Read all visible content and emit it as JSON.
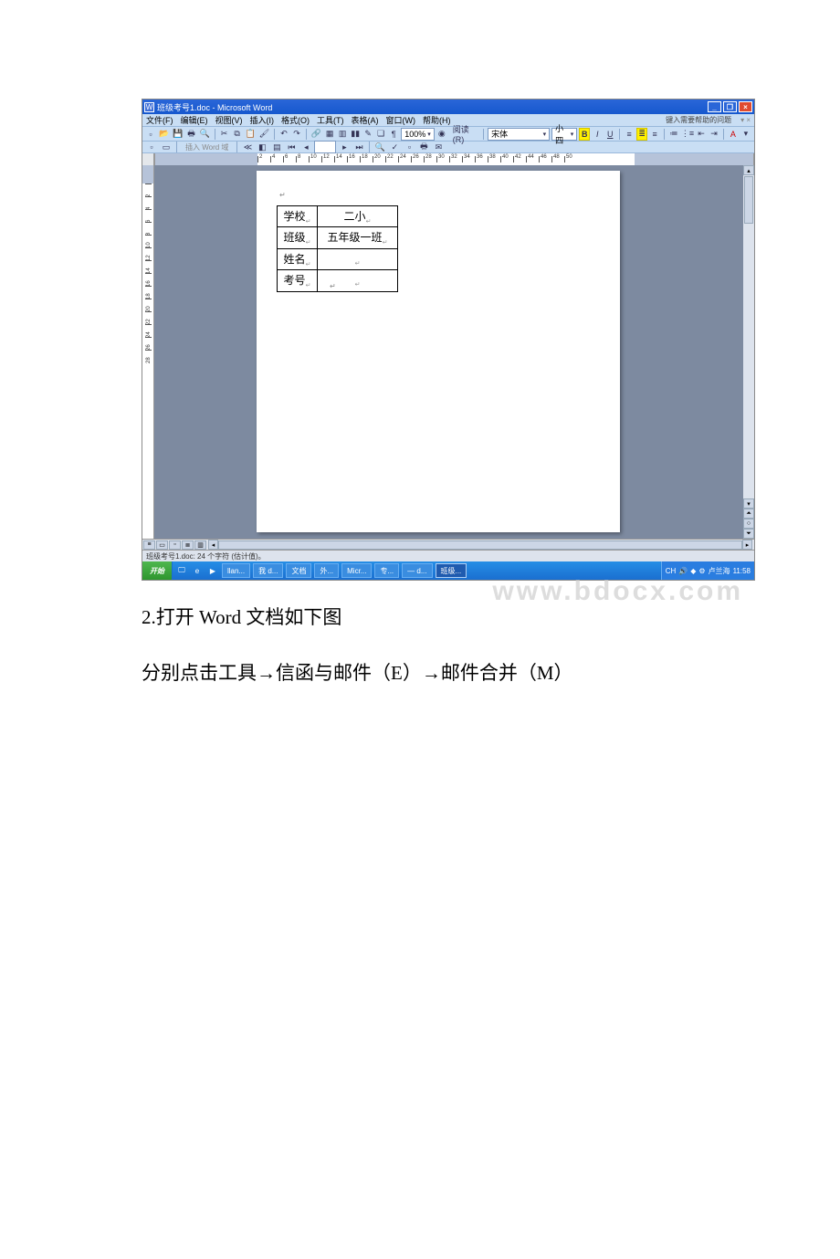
{
  "word_window": {
    "title_icon": "W",
    "title": "班级考号1.doc - Microsoft Word",
    "help_hint": "键入需要帮助的问题",
    "help_x": "▾ ×",
    "win_min": "_",
    "win_max": "❐",
    "win_close": "×",
    "menus": [
      "文件(F)",
      "编辑(E)",
      "视图(V)",
      "插入(I)",
      "格式(O)",
      "工具(T)",
      "表格(A)",
      "窗口(W)",
      "帮助(H)"
    ],
    "toolbar1": {
      "zoom": "100%",
      "read_btn": "阅读(R)",
      "font_name": "宋体",
      "font_size": "小四"
    },
    "toolbar2_label": "插入 Word 域",
    "ruler_ticks": [
      "2",
      "4",
      "6",
      "8",
      "10",
      "12",
      "14",
      "16",
      "18",
      "20",
      "22",
      "24",
      "26",
      "28",
      "30",
      "32",
      "34",
      "36",
      "38",
      "40",
      "42",
      "44",
      "46",
      "48",
      "50"
    ],
    "vruler_ticks": [
      "2",
      "4",
      "6",
      "8",
      "10",
      "12",
      "14",
      "16",
      "18",
      "20",
      "22",
      "24",
      "26",
      "28"
    ],
    "table": {
      "r1l": "学校",
      "r1v": "二小",
      "r2l": "班级",
      "r2v": "五年级一班",
      "r3l": "姓名",
      "r3v": "",
      "r4l": "考号",
      "r4v": ""
    },
    "status": "班级考号1.doc: 24 个字符 (估计值)。",
    "taskbar": {
      "start": "开始",
      "items": [
        "llan...",
        "我 d...",
        "文档",
        "外...",
        "Micr...",
        "专...",
        "— d...",
        "班级..."
      ],
      "lang": "CH",
      "tray_user": "卢兰海",
      "clock": "11:58"
    }
  },
  "watermark": "www.bdocx.com",
  "body": {
    "line1_prefix": "2.",
    "line1_mid1": "打开 ",
    "line1_word": "Word ",
    "line1_mid2": "文档如下图",
    "line2": "分别点击工具→信函与邮件（E）→邮件合并（M）"
  }
}
